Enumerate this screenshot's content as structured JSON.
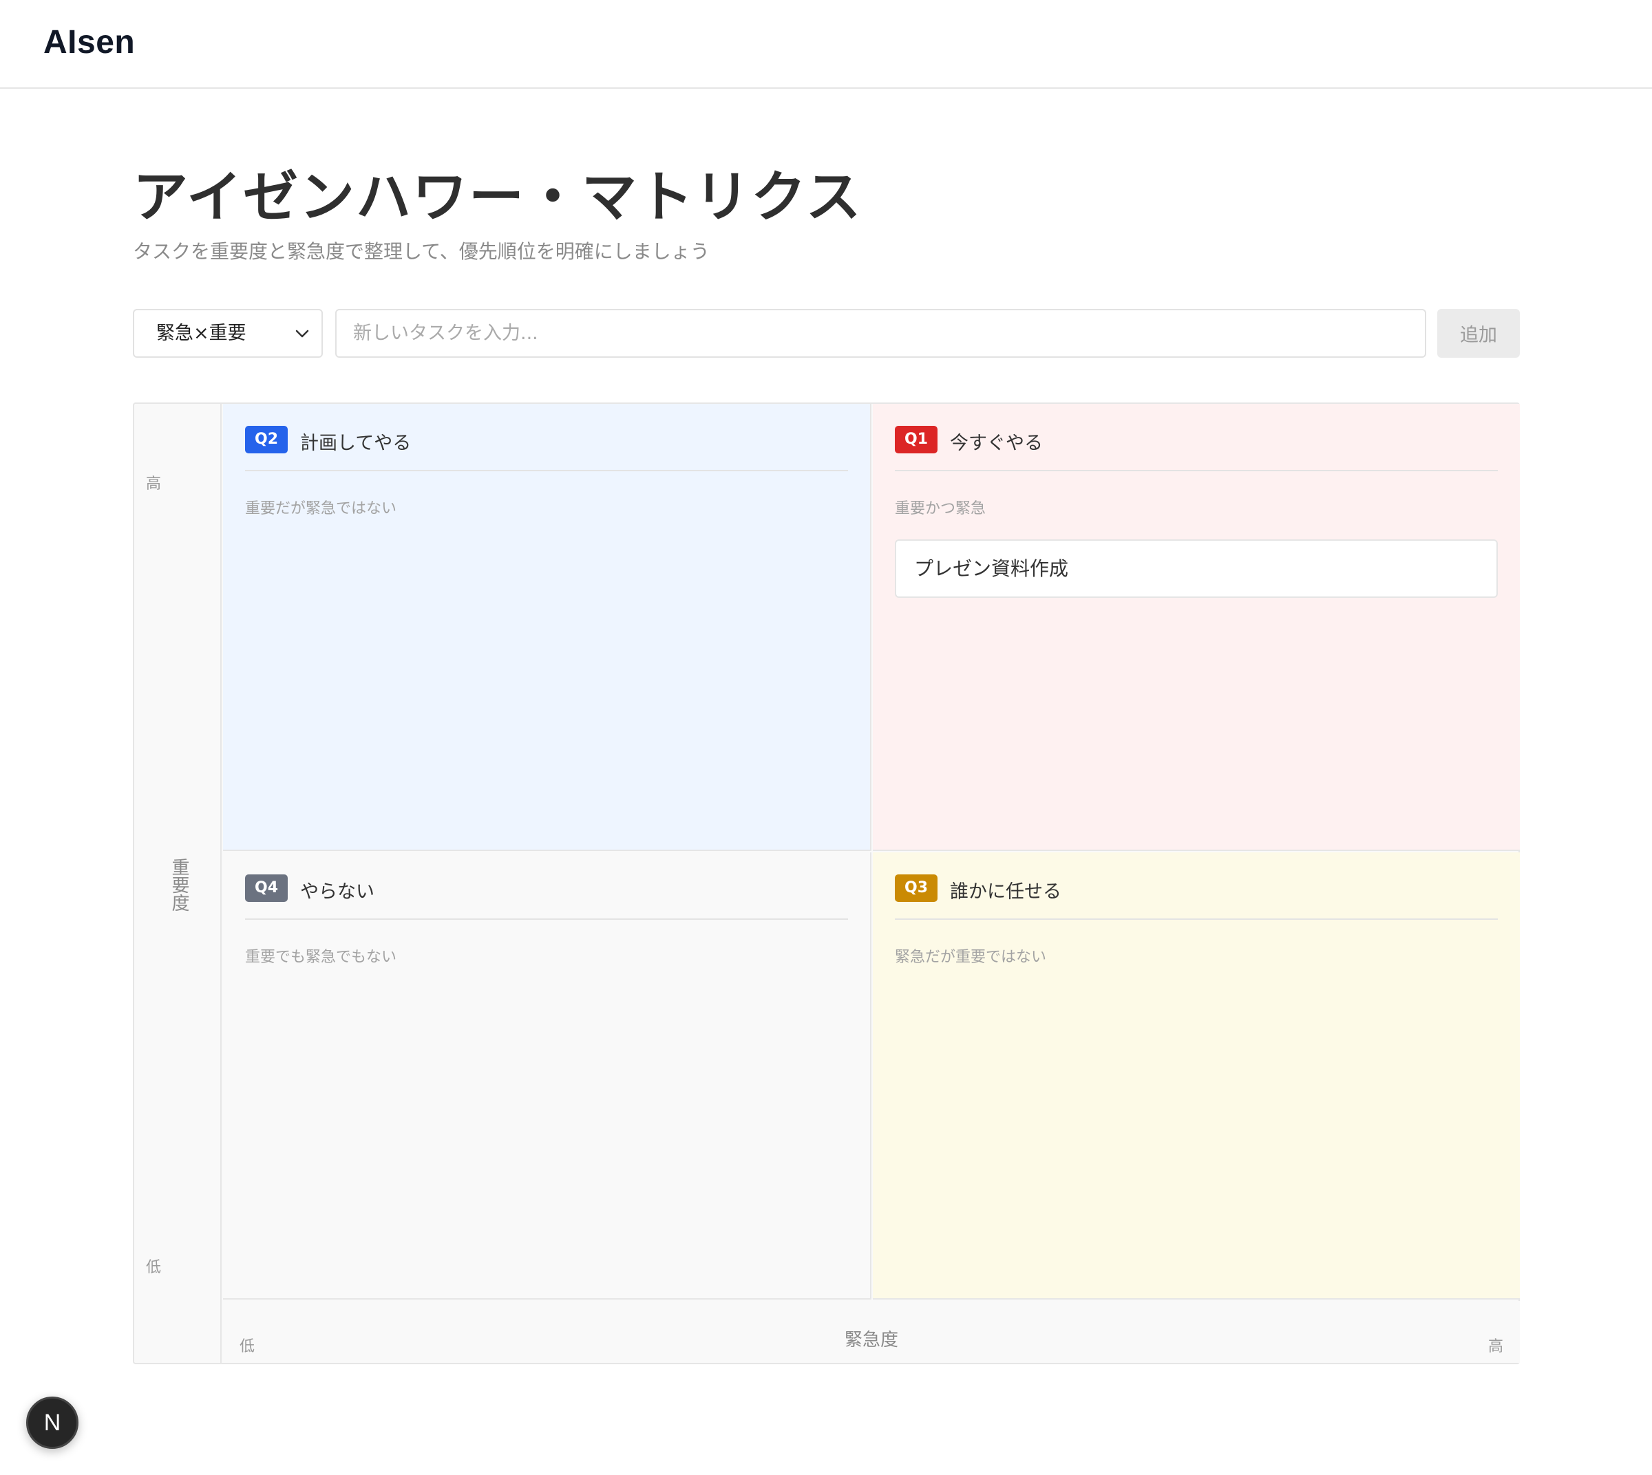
{
  "app": {
    "brand": "AIsen"
  },
  "page": {
    "title": "アイゼンハワー・マトリクス",
    "subtitle": "タスクを重要度と緊急度で整理して、優先順位を明確にしましょう"
  },
  "form": {
    "quadrant_select_value": "緊急×重要",
    "task_placeholder": "新しいタスクを入力...",
    "add_label": "追加"
  },
  "matrix": {
    "y_axis": {
      "label": "重要度",
      "high": "高",
      "low": "低"
    },
    "x_axis": {
      "label": "緊急度",
      "high": "高",
      "low": "低"
    },
    "quadrants": {
      "q2": {
        "badge": "Q2",
        "title": "計画してやる",
        "description": "重要だが緊急ではない",
        "badge_color": "#2563eb",
        "tasks": []
      },
      "q1": {
        "badge": "Q1",
        "title": "今すぐやる",
        "description": "重要かつ緊急",
        "badge_color": "#dc2626",
        "tasks": [
          "プレゼン資料作成"
        ]
      },
      "q4": {
        "badge": "Q4",
        "title": "やらない",
        "description": "重要でも緊急でもない",
        "badge_color": "#6b7280",
        "tasks": []
      },
      "q3": {
        "badge": "Q3",
        "title": "誰かに任せる",
        "description": "緊急だが重要ではない",
        "badge_color": "#ca8a04",
        "tasks": []
      }
    }
  },
  "dev_indicator": {
    "label": "N"
  },
  "colors": {
    "q1_bg": "#fef1f1",
    "q2_bg": "#eef5ff",
    "q3_bg": "#fdfae7",
    "q4_bg": "#f9f9f9"
  }
}
